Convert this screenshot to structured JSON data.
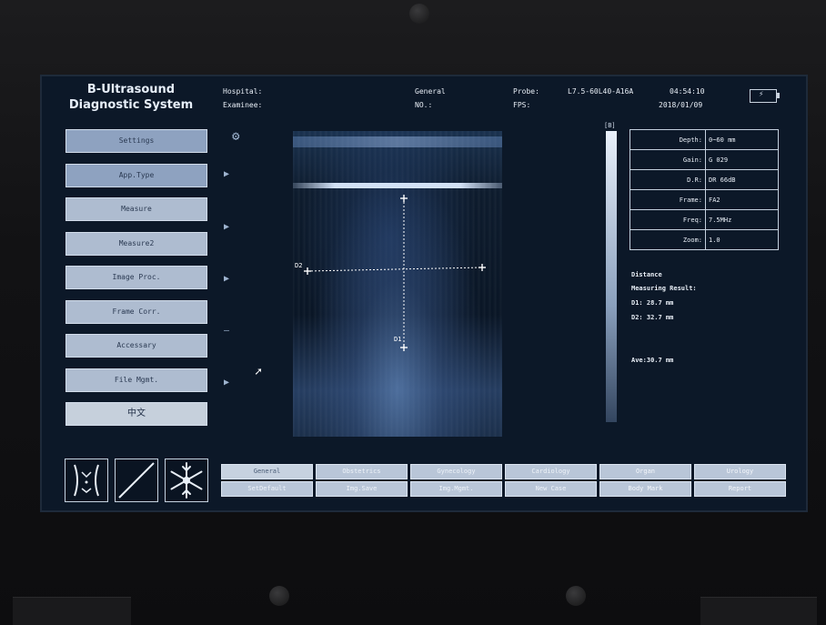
{
  "header": {
    "title_line1": "B-Ultrasound",
    "title_line2": "Diagnostic System",
    "hospital_label": "Hospital:",
    "examinee_label": "Examinee:",
    "mode": "General",
    "no_label": "NO.:",
    "probe_label": "Probe:",
    "probe_value": "L7.5-60L40-A16A",
    "fps_label": "FPS:",
    "time": "04:54:10",
    "date": "2018/01/09",
    "battery_icon": "battery-charging-icon"
  },
  "menu": [
    {
      "label": "Settings"
    },
    {
      "label": "App.Type"
    },
    {
      "label": "Measure"
    },
    {
      "label": "Measure2"
    },
    {
      "label": "Image Proc."
    },
    {
      "label": "Frame Corr."
    },
    {
      "label": "Accessary"
    },
    {
      "label": "File Mgmt."
    },
    {
      "label": "中文"
    }
  ],
  "image": {
    "label_d1": "D1",
    "label_d2": "D2"
  },
  "grayscale": {
    "tag": "[B]"
  },
  "params": [
    {
      "key": "Depth:",
      "value": "0~60 mm"
    },
    {
      "key": "Gain:",
      "value": "G 029"
    },
    {
      "key": "D.R:",
      "value": "DR 66dB"
    },
    {
      "key": "Frame:",
      "value": "FA2"
    },
    {
      "key": "Freq:",
      "value": "7.5MHz"
    },
    {
      "key": "Zoom:",
      "value": "1.0"
    }
  ],
  "results": {
    "type": "Distance",
    "heading": "Measuring Result:",
    "d1": "D1: 28.7 mm",
    "d2": "D2: 32.7 mm",
    "ave": "Ave:30.7 mm"
  },
  "icons": [
    "body-mark-icon",
    "image-line-icon",
    "freeze-snowflake-icon"
  ],
  "bottom_row1": [
    "General",
    "Obstetrics",
    "Gynecology",
    "Cardiology",
    "Organ",
    "Urology"
  ],
  "bottom_row2": [
    "SetDefault",
    "Img.Save",
    "Img.Mgmt.",
    "New Case",
    "Body Mark",
    "Report"
  ]
}
